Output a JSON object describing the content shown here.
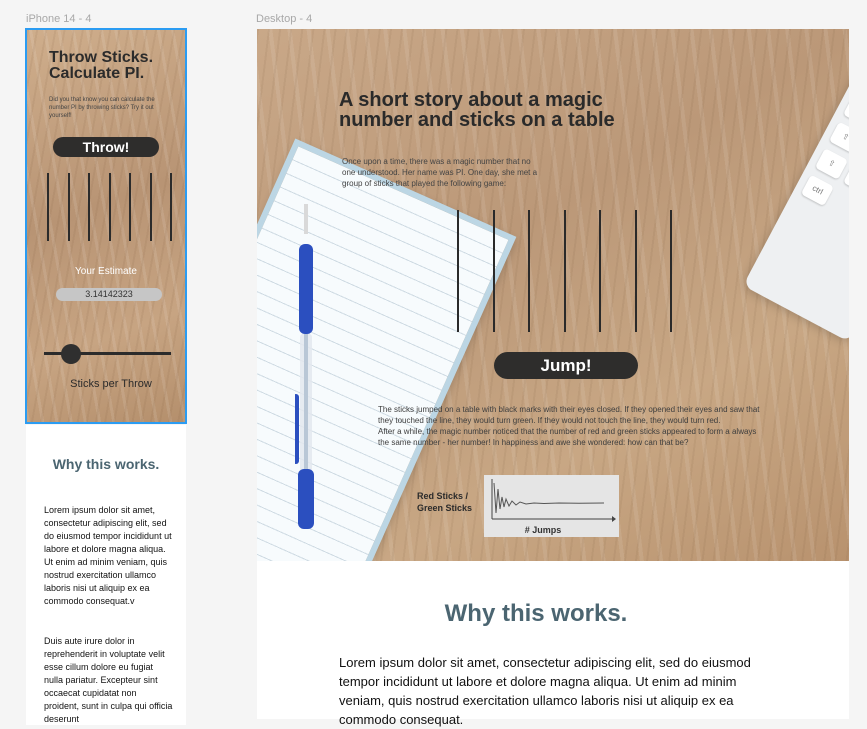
{
  "frames": {
    "phone_label": "iPhone 14 - 4",
    "desktop_label": "Desktop - 4"
  },
  "phone": {
    "title_line1": "Throw Sticks.",
    "title_line2": "Calculate PI.",
    "intro": "Did you that know you can calculate the number PI by throwing sticks? Try it out yourself!",
    "throw_button": "Throw!",
    "stick_count": 7,
    "estimate_label": "Your Estimate",
    "estimate_value": "3.14142323",
    "slider_label": "Sticks per Throw",
    "slider_value_fraction": 0.2,
    "why_title": "Why this works.",
    "lorem_p1": "Lorem ipsum dolor sit amet, consectetur adipiscing elit, sed do eiusmod tempor incididunt ut labore et dolore magna aliqua. Ut enim ad minim veniam, quis nostrud exercitation ullamco laboris nisi ut aliquip ex ea commodo consequat.v",
    "lorem_p2": "Duis aute irure dolor in reprehenderit in voluptate velit esse cillum dolore eu fugiat nulla pariatur. Excepteur sint occaecat cupidatat non proident, sunt in culpa qui officia deserunt"
  },
  "desktop": {
    "title_line1": "A short story about a magic",
    "title_line2": "number and sticks on a table",
    "intro": "Once upon a time, there was a magic number that no one understood. Her name was PI. One day, she met a group of sticks that played the following game:",
    "stick_count": 7,
    "jump_button": "Jump!",
    "body_p1": "The sticks jumped on a table with black marks with their eyes closed. If they opened their eyes and saw that they touched the line, they would turn green. If they would not touch the line, they would turn red.",
    "body_p2": "After a while, the magic number noticed that the number of red and green sticks appeared to form a always the same number - her number! In happiness and awe she wondered: how can that be?",
    "chart_ylabel_line1": "Red Sticks /",
    "chart_ylabel_line2": "Green Sticks",
    "chart_xlabel": "# Jumps",
    "why_title": "Why this works.",
    "lorem": "Lorem ipsum dolor sit amet, consectetur adipiscing elit, sed do eiusmod tempor incididunt ut labore et dolore magna aliqua. Ut enim ad minim veniam, quis nostrud exercitation ullamco laboris nisi ut aliquip ex ea commodo consequat."
  },
  "colors": {
    "accent_selection": "#2b9cf2",
    "why_heading": "#4b6571",
    "button_bg": "#2e2d2c"
  },
  "icons": [
    "pen-image",
    "notebook-image",
    "keyboard-image"
  ]
}
